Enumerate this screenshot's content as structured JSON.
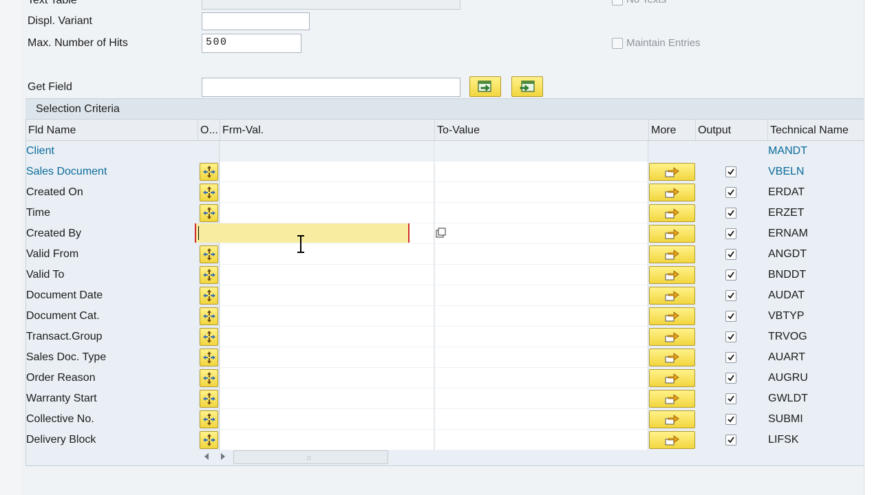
{
  "top_form": {
    "text_table_label": "Text Table",
    "displ_variant_label": "Displ. Variant",
    "displ_variant_value": "",
    "max_hits_label": "Max. Number of Hits",
    "max_hits_value": "500",
    "get_field_label": "Get Field",
    "get_field_value": "",
    "no_texts_label": "No Texts",
    "maintain_entries_label": "Maintain Entries"
  },
  "selection": {
    "title": "Selection Criteria",
    "columns": {
      "fld_name": "Fld Name",
      "option": "O...",
      "from_value": "Frm-Val.",
      "to_value": "To-Value",
      "more": "More",
      "output": "Output",
      "technical_name": "Technical Name"
    },
    "rows": [
      {
        "name": "Client",
        "tech": "MANDT"
      },
      {
        "name": "Sales Document",
        "tech": "VBELN"
      },
      {
        "name": "Created On",
        "tech": "ERDAT"
      },
      {
        "name": "Time",
        "tech": "ERZET"
      },
      {
        "name": "Created By",
        "tech": "ERNAM"
      },
      {
        "name": "Valid From",
        "tech": "ANGDT"
      },
      {
        "name": "Valid To",
        "tech": "BNDDT"
      },
      {
        "name": "Document Date",
        "tech": "AUDAT"
      },
      {
        "name": "Document Cat.",
        "tech": "VBTYP"
      },
      {
        "name": "Transact.Group",
        "tech": "TRVOG"
      },
      {
        "name": "Sales Doc. Type",
        "tech": "AUART"
      },
      {
        "name": "Order Reason",
        "tech": "AUGRU"
      },
      {
        "name": "Warranty Start",
        "tech": "GWLDT"
      },
      {
        "name": "Collective No.",
        "tech": "SUBMI"
      },
      {
        "name": "Delivery Block",
        "tech": "LIFSK"
      }
    ]
  },
  "colors": {
    "link": "#0b6a9c",
    "button_yellow": "#f2d63f",
    "active_field": "#f8eca1",
    "focus_border": "#d12b2b"
  }
}
